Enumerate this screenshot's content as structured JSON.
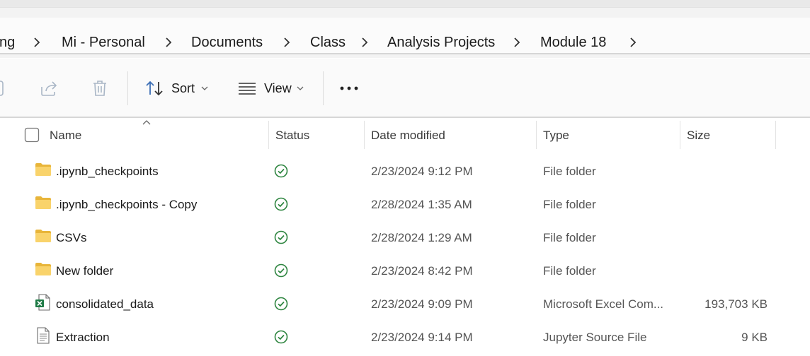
{
  "breadcrumb": {
    "items": [
      "ng",
      "Mi - Personal",
      "Documents",
      "Class",
      "Analysis Projects",
      "Module 18"
    ]
  },
  "toolbar": {
    "sort_label": "Sort",
    "view_label": "View"
  },
  "columns": {
    "name": "Name",
    "status": "Status",
    "date": "Date modified",
    "type": "Type",
    "size": "Size"
  },
  "files": [
    {
      "name": ".ipynb_checkpoints",
      "date": "2/23/2024 9:12 PM",
      "type": "File folder",
      "size": "",
      "icon": "folder-icon",
      "status": "synced"
    },
    {
      "name": ".ipynb_checkpoints - Copy",
      "date": "2/28/2024 1:35 AM",
      "type": "File folder",
      "size": "",
      "icon": "folder-icon",
      "status": "synced"
    },
    {
      "name": "CSVs",
      "date": "2/28/2024 1:29 AM",
      "type": "File folder",
      "size": "",
      "icon": "folder-icon",
      "status": "synced"
    },
    {
      "name": "New folder",
      "date": "2/23/2024 8:42 PM",
      "type": "File folder",
      "size": "",
      "icon": "folder-icon",
      "status": "synced"
    },
    {
      "name": "consolidated_data",
      "date": "2/23/2024 9:09 PM",
      "type": "Microsoft Excel Com...",
      "size": "193,703 KB",
      "icon": "excel-file-icon",
      "status": "synced"
    },
    {
      "name": "Extraction",
      "date": "2/23/2024 9:14 PM",
      "type": "Jupyter Source File",
      "size": "9 KB",
      "icon": "document-icon",
      "status": "synced"
    }
  ],
  "colors": {
    "accent": "#0067c0",
    "status_ok": "#2e8540",
    "folder": "#f4c94e"
  }
}
